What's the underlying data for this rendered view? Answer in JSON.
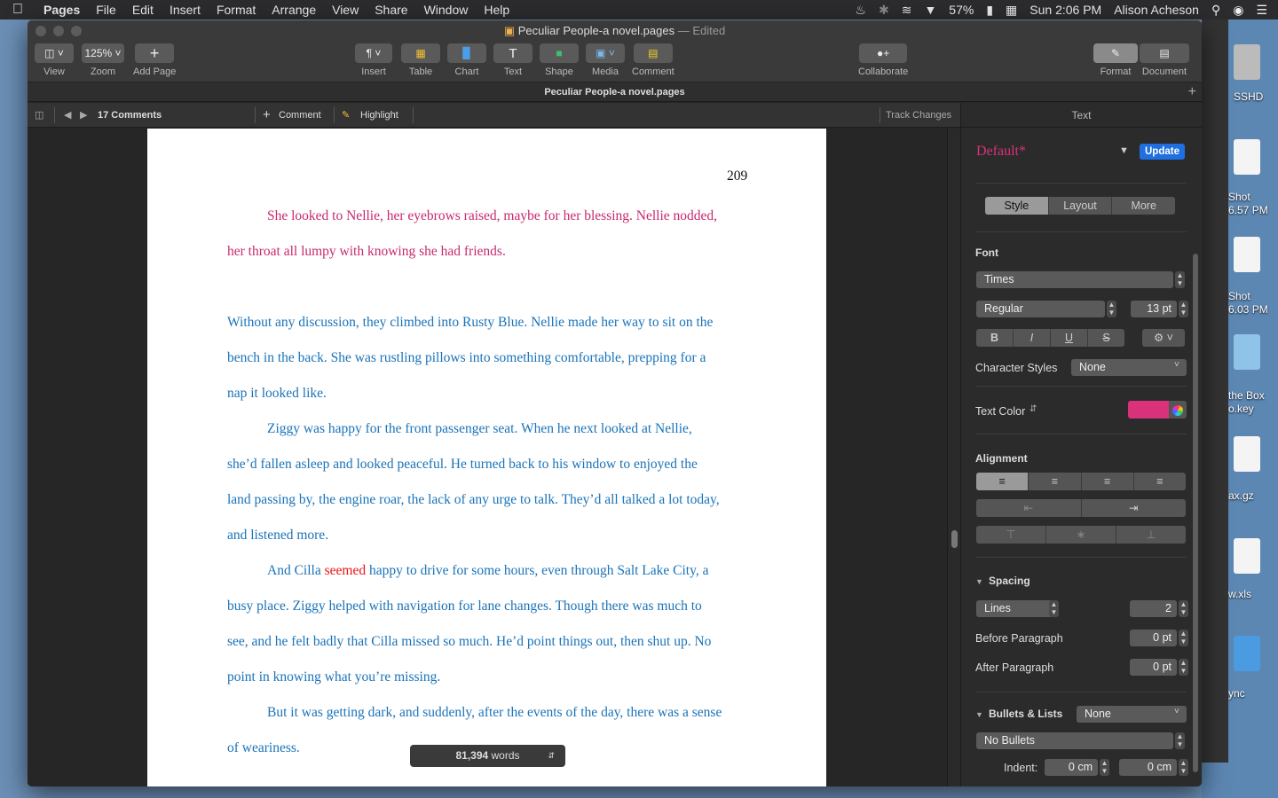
{
  "menubar": {
    "app": "Pages",
    "items": [
      "File",
      "Edit",
      "Insert",
      "Format",
      "Arrange",
      "View",
      "Share",
      "Window",
      "Help"
    ],
    "battery": "57%",
    "clock": "Sun 2:06 PM",
    "user": "Alison Acheson"
  },
  "desktop": {
    "items": [
      "SSHD",
      "Shot",
      "6.57 PM",
      "Shot",
      "6.03 PM",
      "the Box",
      "o.key",
      "ax.gz",
      "w.xls",
      "ync"
    ]
  },
  "window": {
    "title": "Peculiar People-a novel.pages",
    "title_suffix": "— Edited",
    "tab_title": "Peculiar People-a novel.pages",
    "toolbar": {
      "view": "View",
      "zoom_value": "125%",
      "zoom": "Zoom",
      "add_page": "Add Page",
      "insert": "Insert",
      "table": "Table",
      "chart": "Chart",
      "text": "Text",
      "shape": "Shape",
      "media": "Media",
      "comment": "Comment",
      "collaborate": "Collaborate",
      "format": "Format",
      "document": "Document"
    }
  },
  "commentbar": {
    "count": "17 Comments",
    "comment": "Comment",
    "highlight": "Highlight",
    "track_changes": "Track Changes"
  },
  "document": {
    "page_number": "209",
    "lines": {
      "l1": "She looked to Nellie, her eyebrows raised, maybe for her blessing. Nellie nodded,",
      "l2": "her throat all lumpy with knowing she had friends.",
      "l3": "Without any discussion, they climbed into Rusty Blue. Nellie made her way to sit on the",
      "l4": "bench in the back. She was rustling pillows into something comfortable, prepping for a",
      "l5": "nap it looked like.",
      "l6": "Ziggy was happy for the front passenger seat. When he next looked at Nellie,",
      "l7": "she’d fallen asleep and looked peaceful. He turned back to his window to enjoyed the",
      "l8": "land passing by, the engine roar, the lack of any urge to talk. They’d all talked a lot today,",
      "l9": "and listened more.",
      "l10a": "And Cilla ",
      "l10b": "seemed",
      "l10c": " happy to drive for some hours, even through Salt Lake City, a",
      "l11": "busy place. Ziggy helped with navigation for lane changes. Though there was much to",
      "l12": "see, and he felt badly that Cilla missed so much. He’d point things out, then shut up. No",
      "l13": "point in knowing what you’re missing.",
      "l14": "But it was getting dark, and suddenly, after the events of the day, there was a sense",
      "l15": "of weariness."
    },
    "word_count": "81,394",
    "word_label": "words"
  },
  "sidebar": {
    "header": "Text",
    "style_name": "Default*",
    "update": "Update",
    "tabs": {
      "style": "Style",
      "layout": "Layout",
      "more": "More"
    },
    "font_label": "Font",
    "font_family": "Times",
    "font_weight": "Regular",
    "font_size": "13 pt",
    "char_styles_label": "Character Styles",
    "char_styles_value": "None",
    "text_color_label": "Text Color",
    "text_color": "#d9317a",
    "alignment_label": "Alignment",
    "spacing_label": "Spacing",
    "spacing_mode": "Lines",
    "spacing_value": "2",
    "before_label": "Before Paragraph",
    "before_value": "0 pt",
    "after_label": "After Paragraph",
    "after_value": "0 pt",
    "bullets_label": "Bullets & Lists",
    "bullets_value": "None",
    "bullets_style": "No Bullets",
    "indent_label": "Indent:",
    "indent_left": "0 cm",
    "indent_right": "0 cm"
  }
}
